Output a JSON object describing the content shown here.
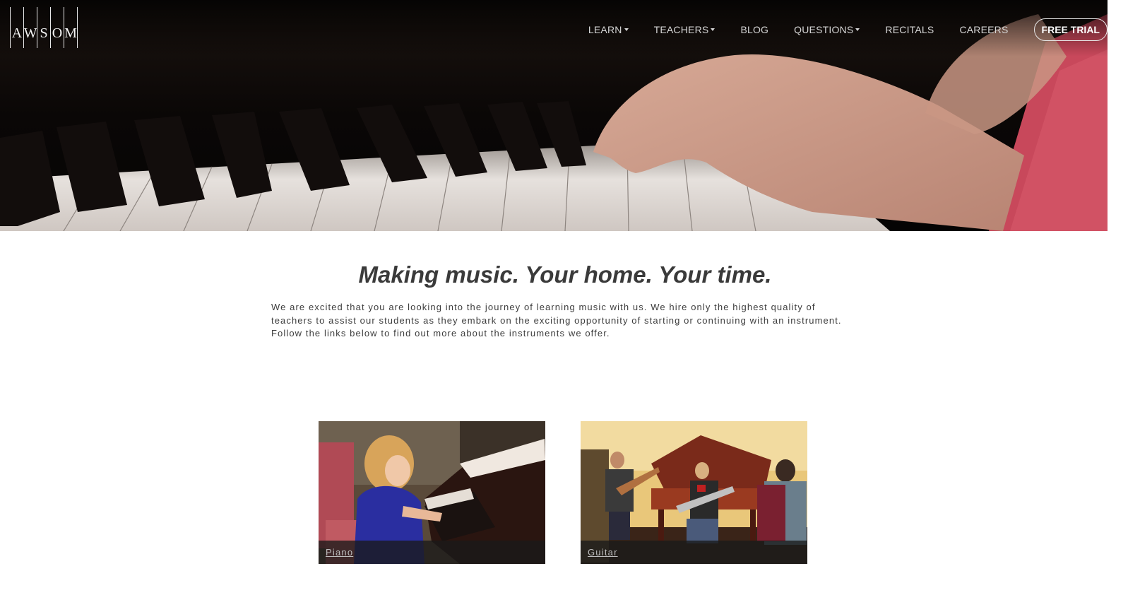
{
  "logo": {
    "letters": [
      "A",
      "W",
      "S",
      "O",
      "M"
    ]
  },
  "nav": {
    "items": [
      {
        "label": "LEARN",
        "dropdown": true
      },
      {
        "label": "TEACHERS",
        "dropdown": true
      },
      {
        "label": "BLOG",
        "dropdown": false
      },
      {
        "label": "QUESTIONS",
        "dropdown": true
      },
      {
        "label": "RECITALS",
        "dropdown": false
      },
      {
        "label": "CAREERS",
        "dropdown": false
      }
    ],
    "cta": "FREE TRIAL"
  },
  "hero": {
    "image": "piano keys with hands playing"
  },
  "intro": {
    "headline": "Making music. Your home. Your time.",
    "body": "We are excited that you are looking into the journey of learning music with us. We hire only the highest quality of teachers to assist our students as they embark on the exciting opportunity of starting or continuing with an instrument. Follow the links below to find out more about the instruments we offer."
  },
  "instruments": [
    {
      "label": "Piano",
      "image": "girl playing grand piano"
    },
    {
      "label": "Guitar",
      "image": "guitar recital in a hall"
    }
  ],
  "colors": {
    "nav_text": "#d6d6d6",
    "headline": "#3a3a3a",
    "hero_bg": "#0c0908"
  }
}
